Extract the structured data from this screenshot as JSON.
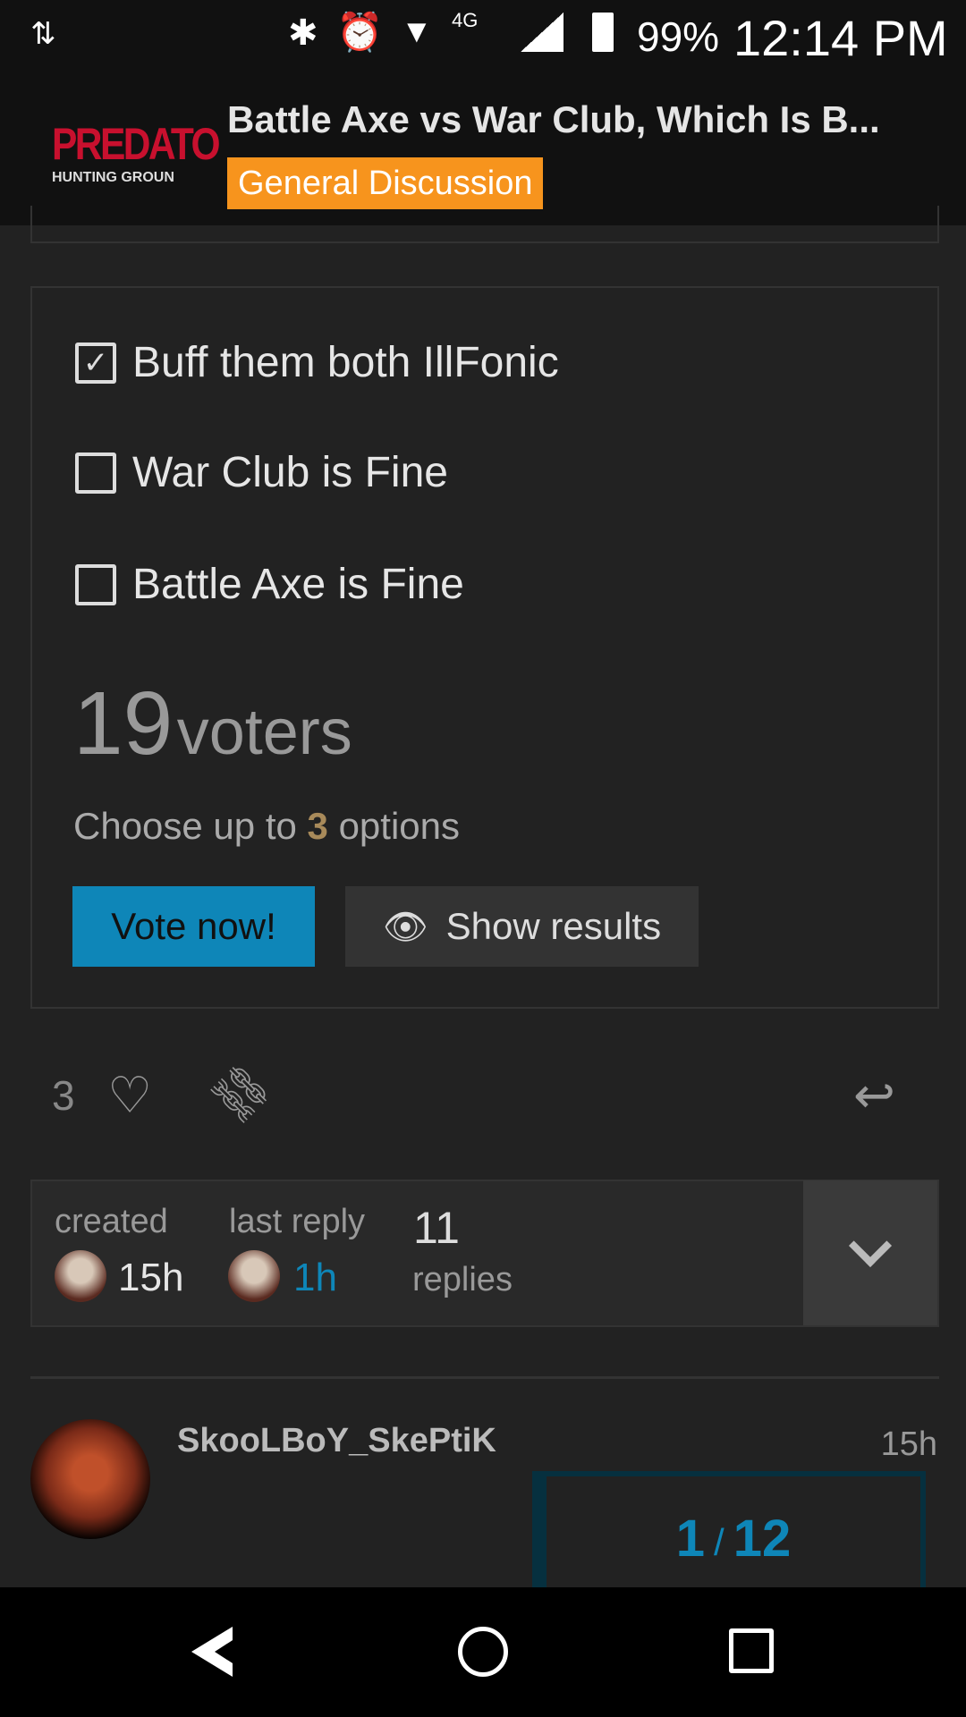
{
  "status_bar": {
    "battery": "99%",
    "time": "12:14 PM",
    "network": "4G"
  },
  "header": {
    "logo_text": "PREDATO",
    "logo_sub": "HUNTING GROUN",
    "title": "Battle Axe vs War Club, Which Is B...",
    "category": "General Discussion",
    "category_color": "#f7941d"
  },
  "poll": {
    "options": [
      {
        "label": "Buff them both IllFonic",
        "checked": true
      },
      {
        "label": "War Club is Fine",
        "checked": false
      },
      {
        "label": "Battle Axe is Fine",
        "checked": false
      }
    ],
    "voters_count": "19",
    "voters_label": "voters",
    "choose_prefix": "Choose up to",
    "choose_count": "3",
    "choose_suffix": "options",
    "vote_label": "Vote now!",
    "results_label": "Show results"
  },
  "actions": {
    "like_count": "3"
  },
  "stats": {
    "created_label": "created",
    "created_value": "15h",
    "last_reply_label": "last reply",
    "last_reply_value": "1h",
    "replies_count": "11",
    "replies_label": "replies"
  },
  "post": {
    "username": "SkooLBoY_SkePtiK",
    "time": "15h"
  },
  "progress": {
    "current": "1",
    "separator": "/",
    "total": "12"
  },
  "accent": "#0e86b8"
}
